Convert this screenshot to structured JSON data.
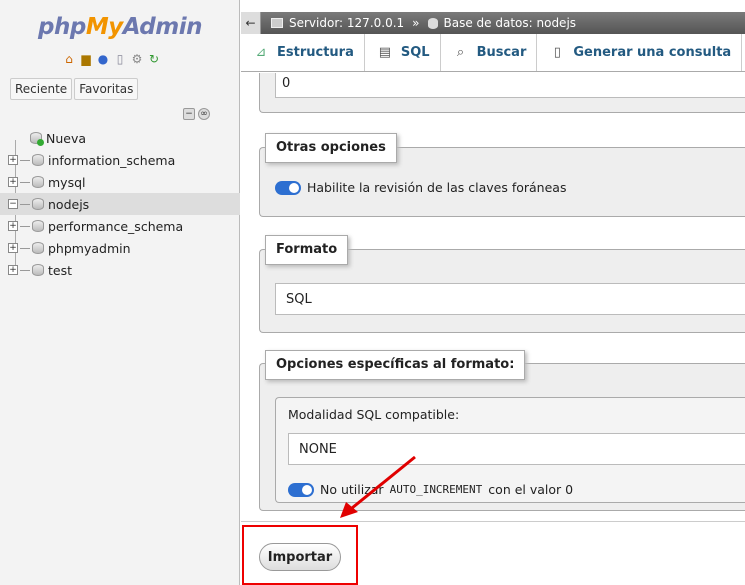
{
  "app": {
    "logo_php": "php",
    "logo_my": "My",
    "logo_admin": "Admin"
  },
  "sidebar": {
    "tabs": [
      "Reciente",
      "Favoritas"
    ],
    "tree": [
      {
        "label": "Nueva",
        "type": "new"
      },
      {
        "label": "information_schema",
        "type": "db"
      },
      {
        "label": "mysql",
        "type": "db"
      },
      {
        "label": "nodejs",
        "type": "db",
        "active": true
      },
      {
        "label": "performance_schema",
        "type": "db"
      },
      {
        "label": "phpmyadmin",
        "type": "db"
      },
      {
        "label": "test",
        "type": "db"
      }
    ]
  },
  "breadcrumb": {
    "server": "Servidor: 127.0.0.1",
    "separator": "»",
    "database": "Base de datos: nodejs"
  },
  "menubar": {
    "items": [
      "Estructura",
      "SQL",
      "Buscar",
      "Generar una consulta"
    ]
  },
  "main": {
    "top_value": "0",
    "otras_opciones": {
      "legend": "Otras opciones",
      "toggle_label": "Habilite la revisión de las claves foráneas"
    },
    "formato": {
      "legend": "Formato",
      "value": "SQL"
    },
    "opciones_formato": {
      "legend": "Opciones específicas al formato:",
      "compat_label": "Modalidad SQL compatible:",
      "compat_value": "NONE",
      "toggle_prefix": "No utilizar",
      "toggle_code": "AUTO_INCREMENT",
      "toggle_suffix": "con el valor 0"
    },
    "import_button": "Importar"
  },
  "colors": {
    "toggle_on": "#2d6fd1",
    "annotation_red": "#e00000",
    "menu_text": "#235a81"
  }
}
